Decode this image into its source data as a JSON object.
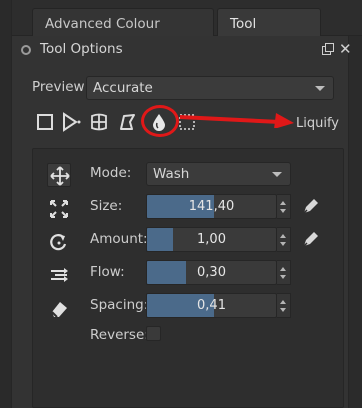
{
  "tabs": [
    {
      "label": "Advanced Colour Selector",
      "active": false
    },
    {
      "label": "Tool Options",
      "active": true
    }
  ],
  "panel": {
    "title": "Tool Options",
    "icons": [
      "grip-icon",
      "float-icon",
      "close-icon"
    ]
  },
  "preview": {
    "label": "Preview",
    "value": "Accurate"
  },
  "tools": [
    "move-icon",
    "free-transform-icon",
    "perspective-icon",
    "warp-icon",
    "liquify-icon",
    "cage-icon"
  ],
  "annotation": {
    "label": "Liquify",
    "color": "#e01818"
  },
  "options": {
    "mode": {
      "label": "Mode:",
      "value": "Wash"
    },
    "size": {
      "label": "Size:",
      "value": "141,40",
      "fill": 0.52
    },
    "amount": {
      "label": "Amount:",
      "value": "1,00",
      "fill": 0.2
    },
    "flow": {
      "label": "Flow:",
      "value": "0,30",
      "fill": 0.3
    },
    "spacing": {
      "label": "Spacing:",
      "value": "0,41",
      "fill": 0.52
    },
    "reverse": {
      "label": "Reverse:",
      "checked": false
    }
  },
  "side_icons": [
    "move-mode-icon",
    "scale-mode-icon",
    "rotate-mode-icon",
    "offset-mode-icon",
    "undo-mode-icon"
  ],
  "colors": {
    "accent": "#4b6a8a",
    "background": "#333333",
    "annotation": "#e01818"
  }
}
